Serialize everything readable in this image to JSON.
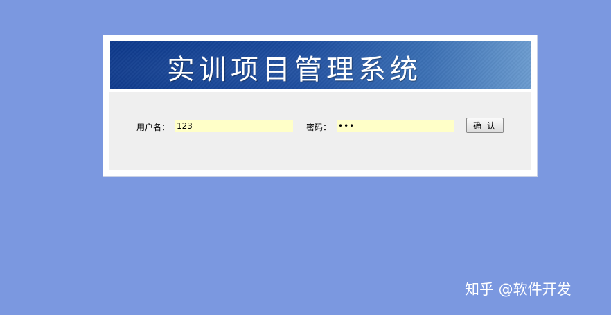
{
  "banner": {
    "title": "实训项目管理系统"
  },
  "login_form": {
    "username_label": "用户名：",
    "username_value": "123",
    "password_label": "密码：",
    "password_value": "123",
    "confirm_label": "确 认"
  },
  "watermark": {
    "text": "知乎 @软件开发"
  },
  "colors": {
    "page_background": "#7b98e0",
    "banner_gradient_start": "#0e3a8c",
    "banner_gradient_end": "#6c9ccf",
    "form_background": "#efefef",
    "input_background": "#ffffc8"
  }
}
